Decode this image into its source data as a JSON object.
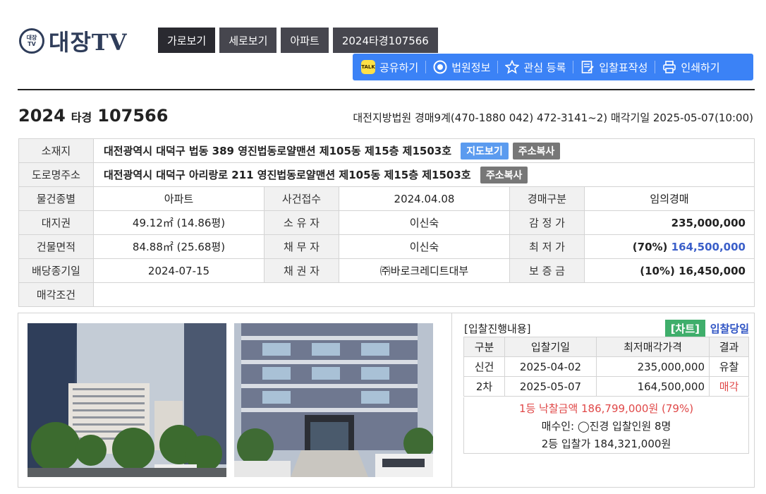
{
  "logo": {
    "badge_top": "대장",
    "badge_bottom": "TV",
    "text": "대장TV"
  },
  "tabs": [
    "가로보기",
    "세로보기",
    "아파트",
    "2024타경107566"
  ],
  "toolbar": {
    "share": "공유하기",
    "court_info": "법원정보",
    "favorite": "관심 등록",
    "bid_form": "입찰표작성",
    "print": "인쇄하기",
    "talk_icon_text": "TALK"
  },
  "case": {
    "year": "2024",
    "kind": "타경",
    "number": "107566"
  },
  "court_line": "대전지방법원 경매9계(470-1880 042) 472-3141~2) 매각기일 2025-05-07(10:00)",
  "info": {
    "location_label": "소재지",
    "location": "대전광역시 대덕구 법동 389 영진법동로얄맨션 제105동 제15층 제1503호",
    "map_btn": "지도보기",
    "copy_btn": "주소복사",
    "road_label": "도로명주소",
    "road": "대전광역시 대덕구 아리랑로 211 영진법동로얄맨션 제105동 제15층 제1503호",
    "type_label": "물건종별",
    "type": "아파트",
    "received_label": "사건접수",
    "received": "2024.04.08",
    "auction_kind_label": "경매구분",
    "auction_kind": "임의경매",
    "land_label": "대지권",
    "land": "49.12㎡ (14.86평)",
    "owner_label": "소 유 자",
    "owner": "이신숙",
    "appraisal_label": "감 정 가",
    "appraisal": "235,000,000",
    "building_label": "건물면적",
    "building": "84.88㎡ (25.68평)",
    "debtor_label": "채 무 자",
    "debtor": "이신숙",
    "min_label": "최 저 가",
    "min_pct": "(70%)",
    "min": "164,500,000",
    "dividend_label": "배당종기일",
    "dividend": "2024-07-15",
    "creditor_label": "채 권 자",
    "creditor": "㈜바로크레디트대부",
    "deposit_label": "보 증 금",
    "deposit": "(10%) 16,450,000",
    "condition_label": "매각조건",
    "condition": ""
  },
  "bids": {
    "title": "[입찰진행내용]",
    "chart_btn": "[차트]",
    "day_link": "입찰당일",
    "headers": [
      "구분",
      "입찰기일",
      "최저매각가격",
      "결과"
    ],
    "rows": [
      [
        "신건",
        "2025-04-02",
        "235,000,000",
        "유찰"
      ],
      [
        "2차",
        "2025-05-07",
        "164,500,000",
        "매각"
      ]
    ],
    "winner_line": "1등 낙찰금액 186,799,000원 (79%)",
    "buyer_line": "매수인: ◯진경 입찰인원 8명",
    "second_line": "2등 입찰가 184,321,000원"
  },
  "colors": {
    "accent": "#3b82f6",
    "sold": "#e04848",
    "link": "#2f54c4",
    "chart": "#3fae6b"
  }
}
